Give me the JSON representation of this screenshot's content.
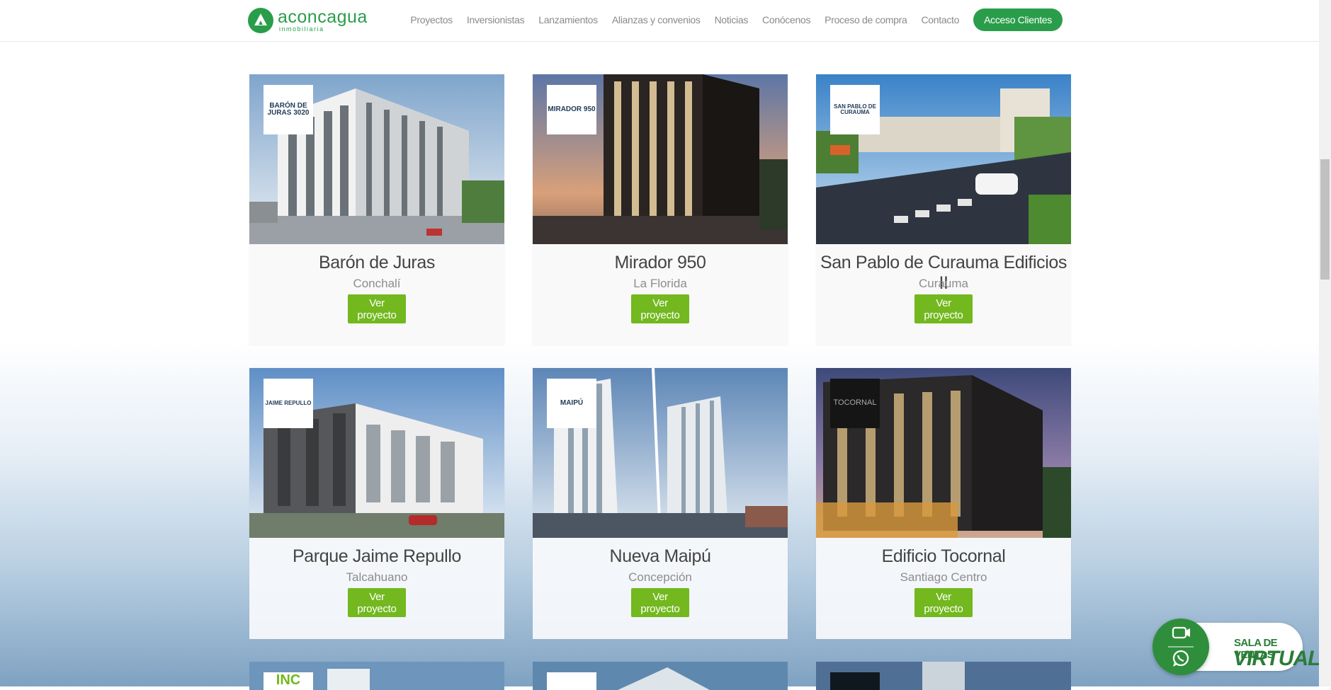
{
  "header": {
    "logo_name": "aconcagua",
    "logo_sub": "inmobiliaria",
    "nav": [
      "Proyectos",
      "Inversionistas",
      "Lanzamientos",
      "Alianzas y convenios",
      "Noticias",
      "Conócenos",
      "Proceso de compra",
      "Contacto"
    ],
    "cta": "Acceso Clientes"
  },
  "projects": [
    {
      "name": "Barón de Juras",
      "location": "Conchalí",
      "button": "Ver proyecto",
      "badge": "BARÓN DE JURAS 3020"
    },
    {
      "name": "Mirador 950",
      "location": "La Florida",
      "button": "Ver proyecto",
      "badge": "MIRADOR 950"
    },
    {
      "name": "San Pablo de Curauma Edificios II",
      "location": "Curauma",
      "button": "Ver proyecto",
      "badge": "SAN PABLO DE CURAUMA"
    },
    {
      "name": "Parque Jaime Repullo",
      "location": "Talcahuano",
      "button": "Ver proyecto",
      "badge": "JAIME REPULLO"
    },
    {
      "name": "Nueva Maipú",
      "location": "Concepción",
      "button": "Ver proyecto",
      "badge": "MAIPÚ"
    },
    {
      "name": "Edificio Tocornal",
      "location": "Santiago Centro",
      "button": "Ver proyecto",
      "badge": "TOCORNAL"
    }
  ],
  "partial_badge": "INC",
  "widget": {
    "line1": "SALA DE VENTAS",
    "line2": "VIRTUAL"
  },
  "colors": {
    "brand_green": "#2a9d4a",
    "button_green": "#72b81e"
  }
}
